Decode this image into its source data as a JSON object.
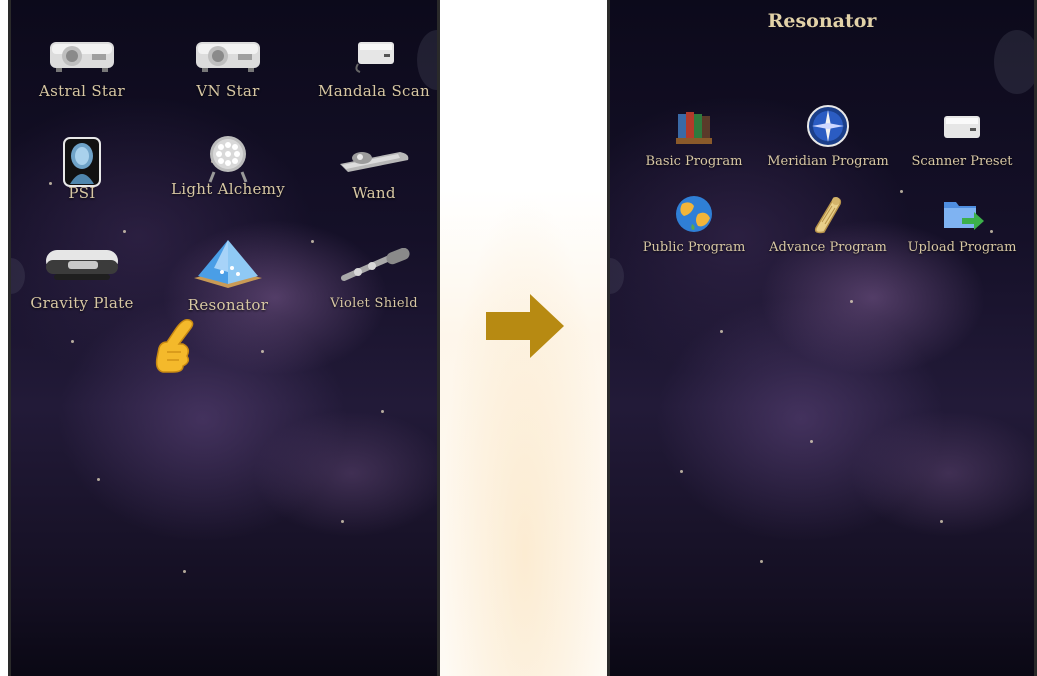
{
  "left_screen": {
    "apps": [
      {
        "label": "Astral Star",
        "icon": "projector-icon"
      },
      {
        "label": "VN Star",
        "icon": "projector-icon"
      },
      {
        "label": "Mandala Scan",
        "icon": "scanner-device-icon"
      },
      {
        "label": "PSI",
        "icon": "head-profile-icon"
      },
      {
        "label": "Light Alchemy",
        "icon": "led-spotlight-icon"
      },
      {
        "label": "Wand",
        "icon": "wand-device-icon"
      },
      {
        "label": "Gravity Plate",
        "icon": "plate-device-icon"
      },
      {
        "label": "Resonator",
        "icon": "pyramid-device-icon"
      },
      {
        "label": "Violet Shield",
        "icon": "shield-device-icon"
      }
    ]
  },
  "right_screen": {
    "title": "Resonator",
    "programs": [
      {
        "label": "Basic Program",
        "icon": "books-icon"
      },
      {
        "label": "Meridian Program",
        "icon": "compass-icon"
      },
      {
        "label": "Scanner Preset",
        "icon": "scanner-icon"
      },
      {
        "label": "Public Program",
        "icon": "globe-icon"
      },
      {
        "label": "Advance Program",
        "icon": "scroll-icon"
      },
      {
        "label": "Upload Program",
        "icon": "folder-upload-icon"
      }
    ]
  },
  "colors": {
    "label": "#d7c7a3",
    "arrow": "#b78a12",
    "hand": "#f4b92b"
  }
}
